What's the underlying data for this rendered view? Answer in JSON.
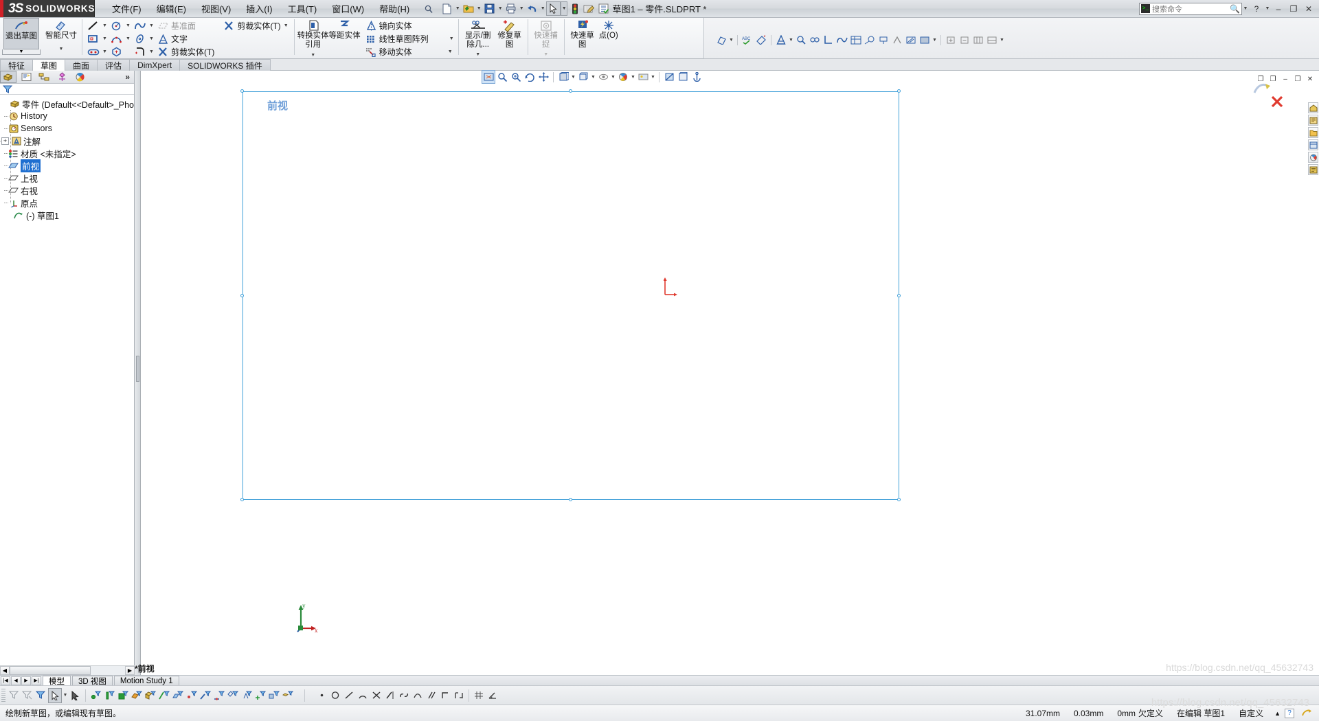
{
  "window": {
    "title": "草图1 – 零件.SLDPRT *",
    "brand_mark": "3S",
    "brand_text": "SOLIDWORKS"
  },
  "menu": {
    "items": [
      {
        "label": "文件(F)",
        "name": "menu-file"
      },
      {
        "label": "编辑(E)",
        "name": "menu-edit"
      },
      {
        "label": "视图(V)",
        "name": "menu-view"
      },
      {
        "label": "插入(I)",
        "name": "menu-insert"
      },
      {
        "label": "工具(T)",
        "name": "menu-tools"
      },
      {
        "label": "窗口(W)",
        "name": "menu-window"
      },
      {
        "label": "帮助(H)",
        "name": "menu-help"
      }
    ]
  },
  "quick_access": {
    "buttons": [
      "new-document-icon",
      "open-folder-icon",
      "save-icon",
      "print-icon",
      "undo-icon",
      "select-arrow-icon",
      "rebuild-icon",
      "options-icon",
      "settings-list-icon"
    ]
  },
  "search": {
    "placeholder": "搜索命令",
    "value": "",
    "icon": "command-prompt-icon",
    "magnifier": "magnifier-icon"
  },
  "window_controls": {
    "help": "?",
    "minimize": "–",
    "restore": "❐",
    "close": "✕"
  },
  "ribbon": {
    "tabs": [
      {
        "label": "特征",
        "active": false,
        "name": "tab-features"
      },
      {
        "label": "草图",
        "active": true,
        "name": "tab-sketch"
      },
      {
        "label": "曲面",
        "active": false,
        "name": "tab-surfaces"
      },
      {
        "label": "评估",
        "active": false,
        "name": "tab-evaluate"
      },
      {
        "label": "DimXpert",
        "active": false,
        "name": "tab-dimxpert"
      },
      {
        "label": "SOLIDWORKS 插件",
        "active": false,
        "name": "tab-solidworks-addins"
      }
    ],
    "exit_sketch": {
      "label": "退出草图",
      "name": "exit-sketch-button"
    },
    "smart_dimension": {
      "label": "智能尺寸",
      "name": "smart-dimension-button"
    },
    "entity_tools": [
      {
        "row": 0,
        "items": [
          {
            "label": "",
            "icon": "line-icon",
            "name": "line-tool",
            "dropdown": true
          },
          {
            "label": "",
            "icon": "circle-icon",
            "name": "circle-tool",
            "dropdown": true
          },
          {
            "label": "",
            "icon": "spline-icon",
            "name": "spline-tool",
            "dropdown": true
          },
          {
            "label": "基准面",
            "icon": "plane-icon",
            "name": "plane-tool",
            "disabled": true
          }
        ]
      },
      {
        "row": 1,
        "items": [
          {
            "label": "",
            "icon": "rectangle-icon",
            "name": "rectangle-tool",
            "dropdown": true
          },
          {
            "label": "",
            "icon": "arc-icon",
            "name": "arc-tool",
            "dropdown": true
          },
          {
            "label": "",
            "icon": "ellipse-icon",
            "name": "ellipse-tool",
            "dropdown": true
          },
          {
            "label": "文字",
            "icon": "text-icon",
            "name": "text-tool"
          }
        ]
      },
      {
        "row": 2,
        "items": [
          {
            "label": "",
            "icon": "slot-icon",
            "name": "slot-tool",
            "dropdown": true
          },
          {
            "label": "",
            "icon": "polygon-icon",
            "name": "polygon-tool"
          },
          {
            "label": "",
            "icon": "fillet-icon",
            "name": "fillet-tool",
            "dropdown": true
          },
          {
            "label": "剪裁实体(T)",
            "icon": "trim-icon",
            "name": "trim-entities-tool"
          }
        ]
      }
    ],
    "trim_top": {
      "label": "剪裁实体(T)",
      "name": "trim-entities-button"
    },
    "convert_entities": {
      "label": "转换实体引用",
      "name": "convert-entities-button"
    },
    "offset_entities": {
      "label": "等距实体",
      "name": "offset-entities-button"
    },
    "pattern_tools": [
      {
        "label": "镜向实体",
        "icon": "mirror-icon",
        "name": "mirror-entities-button"
      },
      {
        "label": "线性草图阵列",
        "icon": "linear-pattern-icon",
        "name": "linear-sketch-pattern-button",
        "dropdown": true
      },
      {
        "label": "移动实体",
        "icon": "move-entities-icon",
        "name": "move-entities-button",
        "dropdown": true
      }
    ],
    "display_delete_relations": {
      "label": "显示/删除几...",
      "name": "display-delete-relations-button"
    },
    "repair_sketch": {
      "label": "修复草图",
      "name": "repair-sketch-button"
    },
    "quick_snaps": {
      "label": "快速捕捉",
      "name": "quick-snaps-button",
      "disabled": true
    },
    "quick_sketch": {
      "label": "快速草图",
      "name": "quick-sketch-button"
    }
  },
  "feature_manager": {
    "tabs": [
      "feature-tree-icon",
      "property-manager-icon",
      "configuration-manager-icon",
      "dimxpert-manager-icon",
      "display-manager-icon"
    ],
    "overflow": "»",
    "filter_icon": "filter-icon",
    "tree": [
      {
        "label": "零件  (Default<<Default>_Pho",
        "icon": "part-icon",
        "level": 0,
        "name": "tree-item-part"
      },
      {
        "label": "History",
        "icon": "history-icon",
        "level": 1,
        "name": "tree-item-history"
      },
      {
        "label": "Sensors",
        "icon": "sensors-icon",
        "level": 1,
        "name": "tree-item-sensors"
      },
      {
        "label": "注解",
        "icon": "annotations-icon",
        "level": 1,
        "expandable": true,
        "name": "tree-item-annotations"
      },
      {
        "label": "材质 <未指定>",
        "icon": "material-icon",
        "level": 1,
        "name": "tree-item-material"
      },
      {
        "label": "前视",
        "icon": "plane-icon",
        "level": 1,
        "selected": true,
        "name": "tree-item-front-plane"
      },
      {
        "label": "上视",
        "icon": "plane-icon",
        "level": 1,
        "name": "tree-item-top-plane"
      },
      {
        "label": "右视",
        "icon": "plane-icon",
        "level": 1,
        "name": "tree-item-right-plane"
      },
      {
        "label": "原点",
        "icon": "origin-icon",
        "level": 1,
        "name": "tree-item-origin"
      },
      {
        "label": "(-) 草图1",
        "icon": "sketch-icon",
        "level": 0,
        "name": "tree-item-sketch1"
      }
    ]
  },
  "graphics": {
    "view_label": "前视",
    "origin_label": "origin-triad",
    "axis_x": "x",
    "axis_y": "y",
    "watermark": "https://blog.csdn.net/qq_45632743"
  },
  "view_toolbar": {
    "buttons": [
      {
        "icon": "zoom-to-fit-icon",
        "name": "zoom-to-fit-button",
        "selected": true
      },
      {
        "icon": "zoom-to-area-icon",
        "name": "zoom-to-area-button"
      },
      {
        "icon": "zoom-in-out-icon",
        "name": "zoom-in-out-button"
      },
      {
        "icon": "rotate-view-icon",
        "name": "rotate-view-button"
      },
      {
        "icon": "pan-icon",
        "name": "pan-button"
      },
      {
        "icon": "view-orientation-icon",
        "name": "view-orientation-button",
        "dropdown": true
      },
      {
        "icon": "display-style-icon",
        "name": "display-style-button",
        "dropdown": true
      },
      {
        "icon": "hide-show-icon",
        "name": "hide-show-items-button",
        "dropdown": true
      },
      {
        "icon": "edit-appearance-icon",
        "name": "edit-appearance-button",
        "dropdown": true
      },
      {
        "icon": "apply-scene-icon",
        "name": "apply-scene-button",
        "dropdown": true
      },
      {
        "icon": "view-settings-icon",
        "name": "view-settings-button",
        "dropdown": true
      },
      {
        "icon": "section-view-icon",
        "name": "section-view-button"
      },
      {
        "icon": "viewport-icon",
        "name": "viewport-button"
      },
      {
        "icon": "anchor-icon",
        "name": "anchor-button"
      }
    ]
  },
  "bottom_tabs": {
    "nav": [
      "first-icon",
      "prev-icon",
      "next-icon",
      "last-icon"
    ],
    "tabs": [
      {
        "label": "模型",
        "active": true,
        "name": "bottom-tab-model"
      },
      {
        "label": "3D 视图",
        "active": false,
        "name": "bottom-tab-3d-views"
      },
      {
        "label": "Motion Study 1",
        "active": false,
        "name": "bottom-tab-motion-study"
      }
    ],
    "status_note": "*前视"
  },
  "statusbar": {
    "message": "绘制新草图，或编辑现有草图。",
    "values": [
      "31.07mm",
      "0.03mm",
      "0mm"
    ],
    "state": "欠定义",
    "edit_mode": "在编辑  草图1",
    "custom": "自定义",
    "caret": "▲",
    "help_badge": "?",
    "watermark": "https://blog.csdn.net/qq_45632743"
  }
}
